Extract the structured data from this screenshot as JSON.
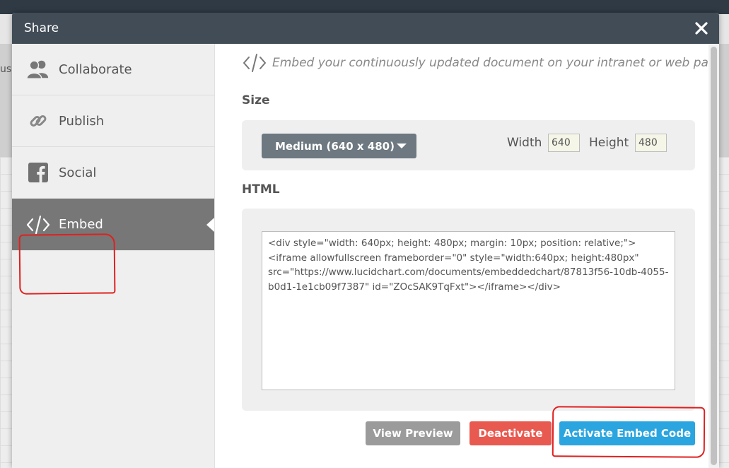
{
  "background": {
    "fragment_text": "us"
  },
  "dialog": {
    "title": "Share",
    "close_icon": "close-icon"
  },
  "sidebar": {
    "items": [
      {
        "label": "Collaborate",
        "icon": "users-icon"
      },
      {
        "label": "Publish",
        "icon": "link-icon"
      },
      {
        "label": "Social",
        "icon": "facebook-icon"
      },
      {
        "label": "Embed",
        "icon": "code-icon",
        "active": true
      }
    ]
  },
  "main": {
    "description": "Embed your continuously updated document on your intranet or web page.",
    "size": {
      "label": "Size",
      "selected": "Medium (640 x 480)",
      "width_label": "Width",
      "width_value": "640",
      "height_label": "Height",
      "height_value": "480"
    },
    "html": {
      "label": "HTML",
      "code": "<div style=\"width: 640px; height: 480px; margin: 10px; position: relative;\"><iframe allowfullscreen frameborder=\"0\" style=\"width:640px; height:480px\" src=\"https://www.lucidchart.com/documents/embeddedchart/87813f56-10db-4055-b0d1-1e1cb09f7387\" id=\"ZOcSAK9TqFxt\"></iframe></div>"
    },
    "buttons": {
      "view_preview": "View Preview",
      "deactivate": "Deactivate",
      "activate": "Activate Embed Code"
    }
  },
  "colors": {
    "header": "#414c56",
    "sidebar_active": "#777777",
    "preview_button": "#9b9b9b",
    "deactivate_button": "#e8594f",
    "activate_button": "#2ba5df",
    "annotation": "#e02020"
  }
}
